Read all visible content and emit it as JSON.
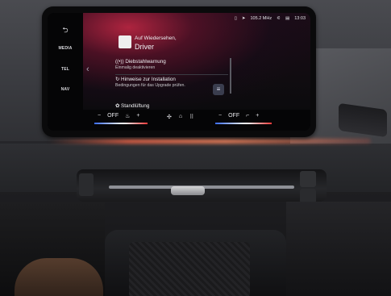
{
  "sidebar": {
    "back_icon": "back-arrow-icon",
    "items": [
      {
        "label": "MEDIA"
      },
      {
        "label": "TEL"
      },
      {
        "label": "NAV"
      }
    ]
  },
  "status_bar": {
    "radio": "105.2 MHz",
    "time": "13:03"
  },
  "welcome": {
    "line1": "Auf Wiedersehen,",
    "line2": "Driver"
  },
  "items": [
    {
      "title": "Diebstahlwarnung",
      "subtitle": "Einmalig deaktivieren"
    },
    {
      "title": "Hinweise zur Installation",
      "subtitle": "Bedingungen für das Upgrade prüfen."
    },
    {
      "title": "Standlüftung",
      "subtitle": ""
    }
  ],
  "climate": {
    "left_label": "OFF",
    "right_label": "OFF",
    "minus": "−",
    "plus": "+"
  },
  "colors": {
    "accent_glow": "#c8283f",
    "ambient_light": "#ff8c64",
    "temp_cold": "#3a6cff",
    "temp_hot": "#ff3a3a"
  }
}
